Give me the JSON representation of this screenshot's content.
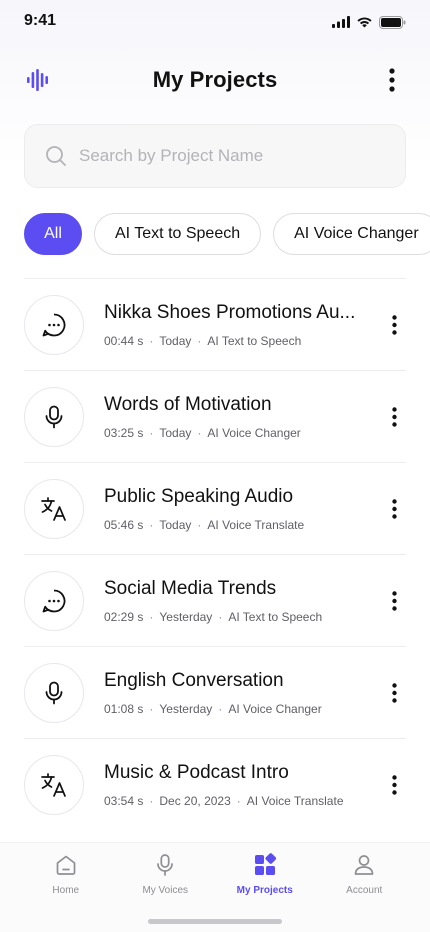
{
  "status_bar": {
    "time": "9:41"
  },
  "header": {
    "title": "My Projects"
  },
  "search": {
    "placeholder": "Search by Project Name",
    "value": ""
  },
  "filters": [
    {
      "label": "All",
      "active": true
    },
    {
      "label": "AI Text to Speech",
      "active": false
    },
    {
      "label": "AI Voice Changer",
      "active": false
    }
  ],
  "projects": [
    {
      "title": "Nikka Shoes Promotions Au...",
      "duration": "00:44 s",
      "date": "Today",
      "type": "AI Text to Speech",
      "icon": "chat-bubble-icon"
    },
    {
      "title": "Words of Motivation",
      "duration": "03:25 s",
      "date": "Today",
      "type": "AI Voice Changer",
      "icon": "microphone-icon"
    },
    {
      "title": "Public Speaking Audio",
      "duration": "05:46 s",
      "date": "Today",
      "type": "AI Voice Translate",
      "icon": "translate-icon"
    },
    {
      "title": "Social Media Trends",
      "duration": "02:29 s",
      "date": "Yesterday",
      "type": "AI Text to Speech",
      "icon": "chat-bubble-icon"
    },
    {
      "title": "English Conversation",
      "duration": "01:08 s",
      "date": "Yesterday",
      "type": "AI Voice Changer",
      "icon": "microphone-icon"
    },
    {
      "title": "Music & Podcast Intro",
      "duration": "03:54 s",
      "date": "Dec 20, 2023",
      "type": "AI Voice Translate",
      "icon": "translate-icon"
    }
  ],
  "separator": "·",
  "tab_bar": {
    "items": [
      {
        "label": "Home",
        "icon": "home-icon",
        "active": false
      },
      {
        "label": "My Voices",
        "icon": "microphone-icon",
        "active": false
      },
      {
        "label": "My Projects",
        "icon": "grid-icon",
        "active": true
      },
      {
        "label": "Account",
        "icon": "user-icon",
        "active": false
      }
    ]
  },
  "colors": {
    "accent": "#5b4df1",
    "text": "#111111",
    "muted": "#5f5f66"
  }
}
